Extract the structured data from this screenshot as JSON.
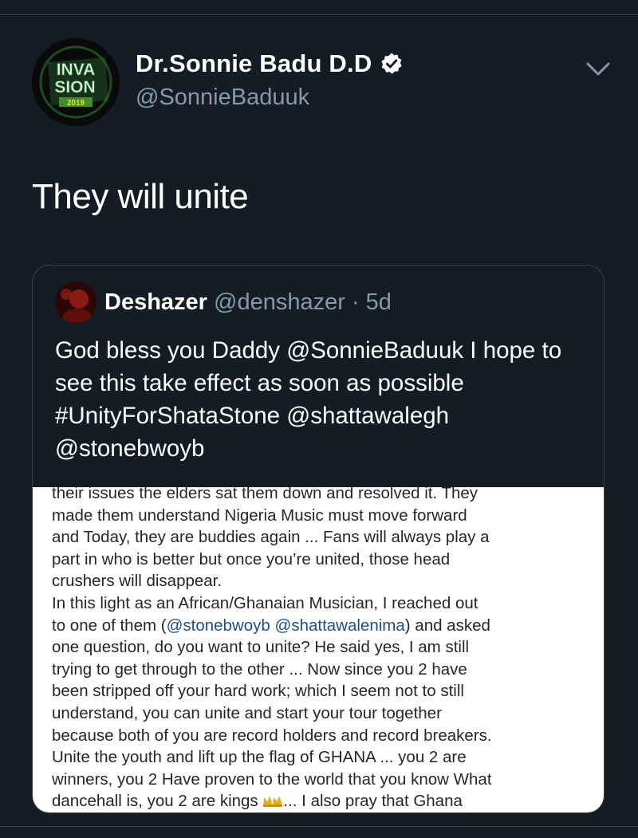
{
  "author": {
    "display_name": "Dr.Sonnie Badu D.D",
    "handle": "@SonnieBaduuk",
    "avatar_lines": [
      "INVA",
      "SION",
      "2019"
    ],
    "verified": true
  },
  "tweet": {
    "text": "They will unite"
  },
  "quoted_tweet": {
    "name": "Deshazer",
    "handle_time": "@denshazer · 5d",
    "text": "God bless you Daddy @SonnieBaduuk I hope to see this take effect as soon as possible #UnityForShataStone @shattawalegh @stonebwoyb",
    "image_lines": [
      "their issues the elders sat them down and resolved it. They",
      "made them understand Nigeria Music must move forward",
      "and Today, they are buddies again ... Fans will always play a",
      "part in who is better but once you’re united, those head",
      "crushers will disappear.",
      "In this light as an African/Ghanaian Musician, I reached out",
      "to one of them (",
      "@stonebwoyb @shattawalenima",
      ") and asked",
      "one question, do you want to unite? He said yes, I am still",
      "trying to get through to the other ... Now since you 2 have",
      "been stripped off your hard work; which I seem not to still",
      "understand, you can unite and start your tour together",
      "because both of you are record holders and record breakers.",
      "Unite the youth and lift up the flag of GHANA ... you 2 are",
      "winners, you 2 Have proven to the world that you know What",
      "dancehall is, you 2 are kings ",
      "... I also pray that  Ghana"
    ]
  },
  "icons": {
    "verified": "verified-badge-icon",
    "caret": "chevron-down-icon",
    "crown": "crown-emoji-icon"
  },
  "colors": {
    "background": "#141d26",
    "secondary_text": "#8899a6",
    "border": "#38444d",
    "mention_in_image": "#1d4e8a"
  }
}
